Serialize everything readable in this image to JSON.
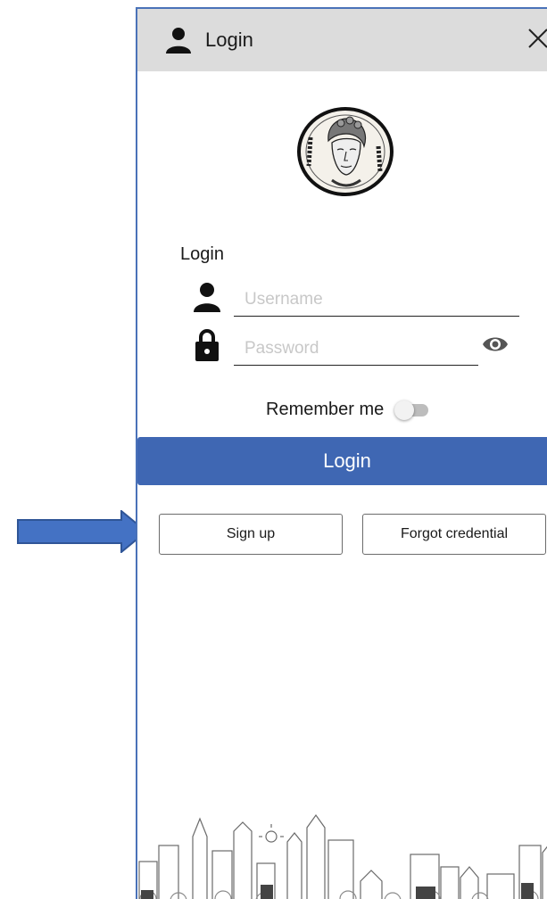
{
  "header": {
    "title": "Login"
  },
  "logo": {
    "alt_icon": "coin-logo"
  },
  "form": {
    "section_label": "Login",
    "username": {
      "placeholder": "Username",
      "value": ""
    },
    "password": {
      "placeholder": "Password",
      "value": ""
    },
    "remember_label": "Remember me",
    "remember_on": false
  },
  "actions": {
    "login_label": "Login",
    "signup_label": "Sign up",
    "forgot_label": "Forgot credential"
  },
  "colors": {
    "accent": "#3f67b3",
    "titlebar": "#dcdcdc",
    "frame_border": "#4a72b8",
    "arrow": "#4472c4"
  },
  "icons": [
    "user-icon",
    "close-icon",
    "lock-icon",
    "eye-icon",
    "arrow-icon"
  ]
}
